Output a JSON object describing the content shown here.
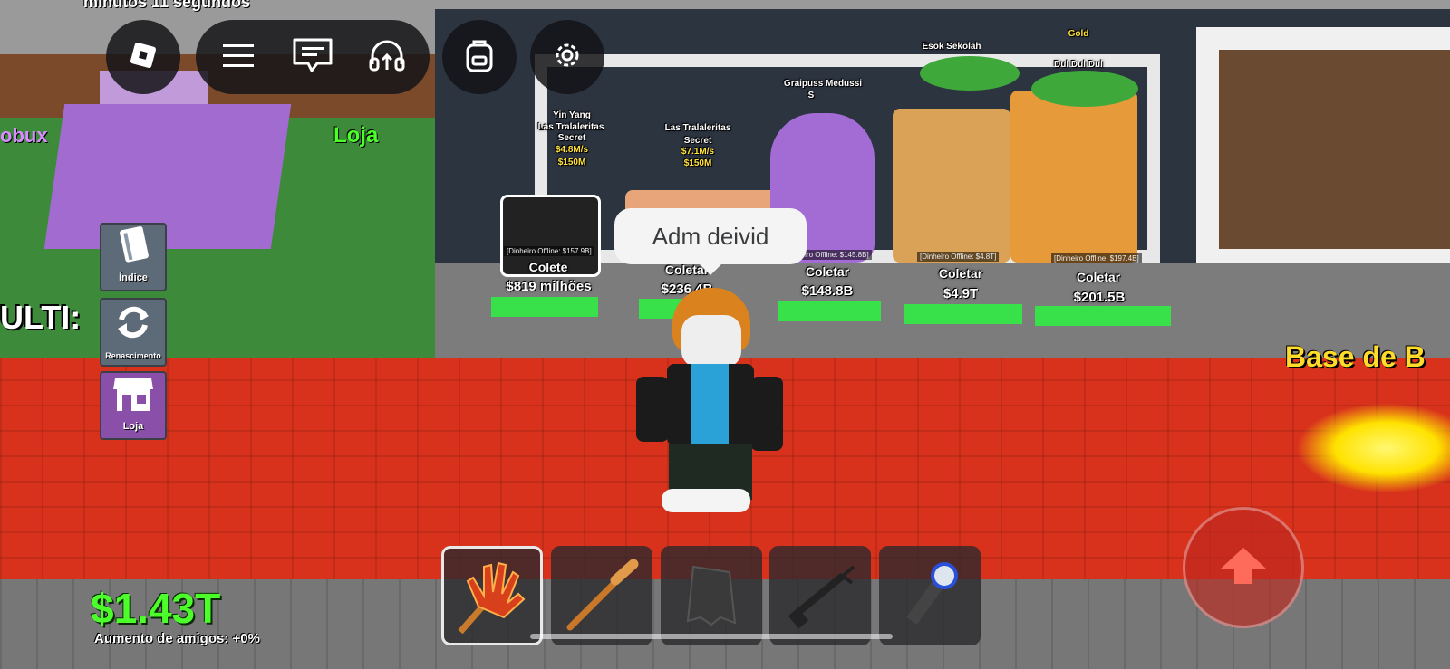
{
  "hud": {
    "timer_text": "minutos 11 segundos",
    "money": "$1.43T",
    "friends_boost": "Aumento de amigos: +0%",
    "ulti_label": "ULTI:",
    "base_label": "Base de B",
    "robux_sign": "obux",
    "loja_sign": "Loja"
  },
  "topbar": {
    "icons": [
      "roblox-logo-icon",
      "menu-icon",
      "chat-icon",
      "headphones-icon",
      "backpack-icon",
      "settings-icon"
    ]
  },
  "sidebar": {
    "items": [
      {
        "label": "Índice",
        "icon": "book-icon"
      },
      {
        "label": "Renascimento",
        "icon": "refresh-icon"
      },
      {
        "label": "Loja",
        "icon": "shop-icon"
      }
    ]
  },
  "chat_bubble": "Adm deivid",
  "brainrots": [
    {
      "name": "Yin Yang",
      "name2": "Las Tralaleritas",
      "rarity": "Secret",
      "rate": "$4.8M/s",
      "price": "$150M",
      "offline": "[Dinheiro Offline: $157.9B]",
      "collect": "Colete",
      "amount": "$819 milhões"
    },
    {
      "name": "Las Tralaleritas",
      "rarity": "Secret",
      "rate": "$7.1M/s",
      "price": "$150M",
      "collect": "Coletar",
      "amount": "$236.4B"
    },
    {
      "name": "Graipuss Medussi",
      "rarity": "S",
      "offline": "[Dinheiro Offline: $145.8B]",
      "collect": "Coletar",
      "amount": "$148.8B"
    },
    {
      "name": "Esok Sekolah",
      "offline": "[Dinheiro Offline: $4.8T]",
      "collect": "Coletar",
      "amount": "$4.9T"
    },
    {
      "name": "Dul Dul Dul",
      "mutation": "Gold",
      "offline": "[Dinheiro Offline: $197.4B]",
      "collect": "Coletar",
      "amount": "$201.5B"
    }
  ],
  "hotbar": {
    "slots": [
      {
        "item": "slap-glove-icon",
        "selected": true
      },
      {
        "item": "bat-icon",
        "selected": false
      },
      {
        "item": "cape-icon",
        "selected": false
      },
      {
        "item": "grapple-gun-icon",
        "selected": false
      },
      {
        "item": "flashlight-icon",
        "selected": false
      }
    ]
  },
  "colors": {
    "money": "#4cff2a",
    "floor_red": "#d8321c",
    "pad_green": "#38e04a",
    "hud_dark": "#141418"
  }
}
